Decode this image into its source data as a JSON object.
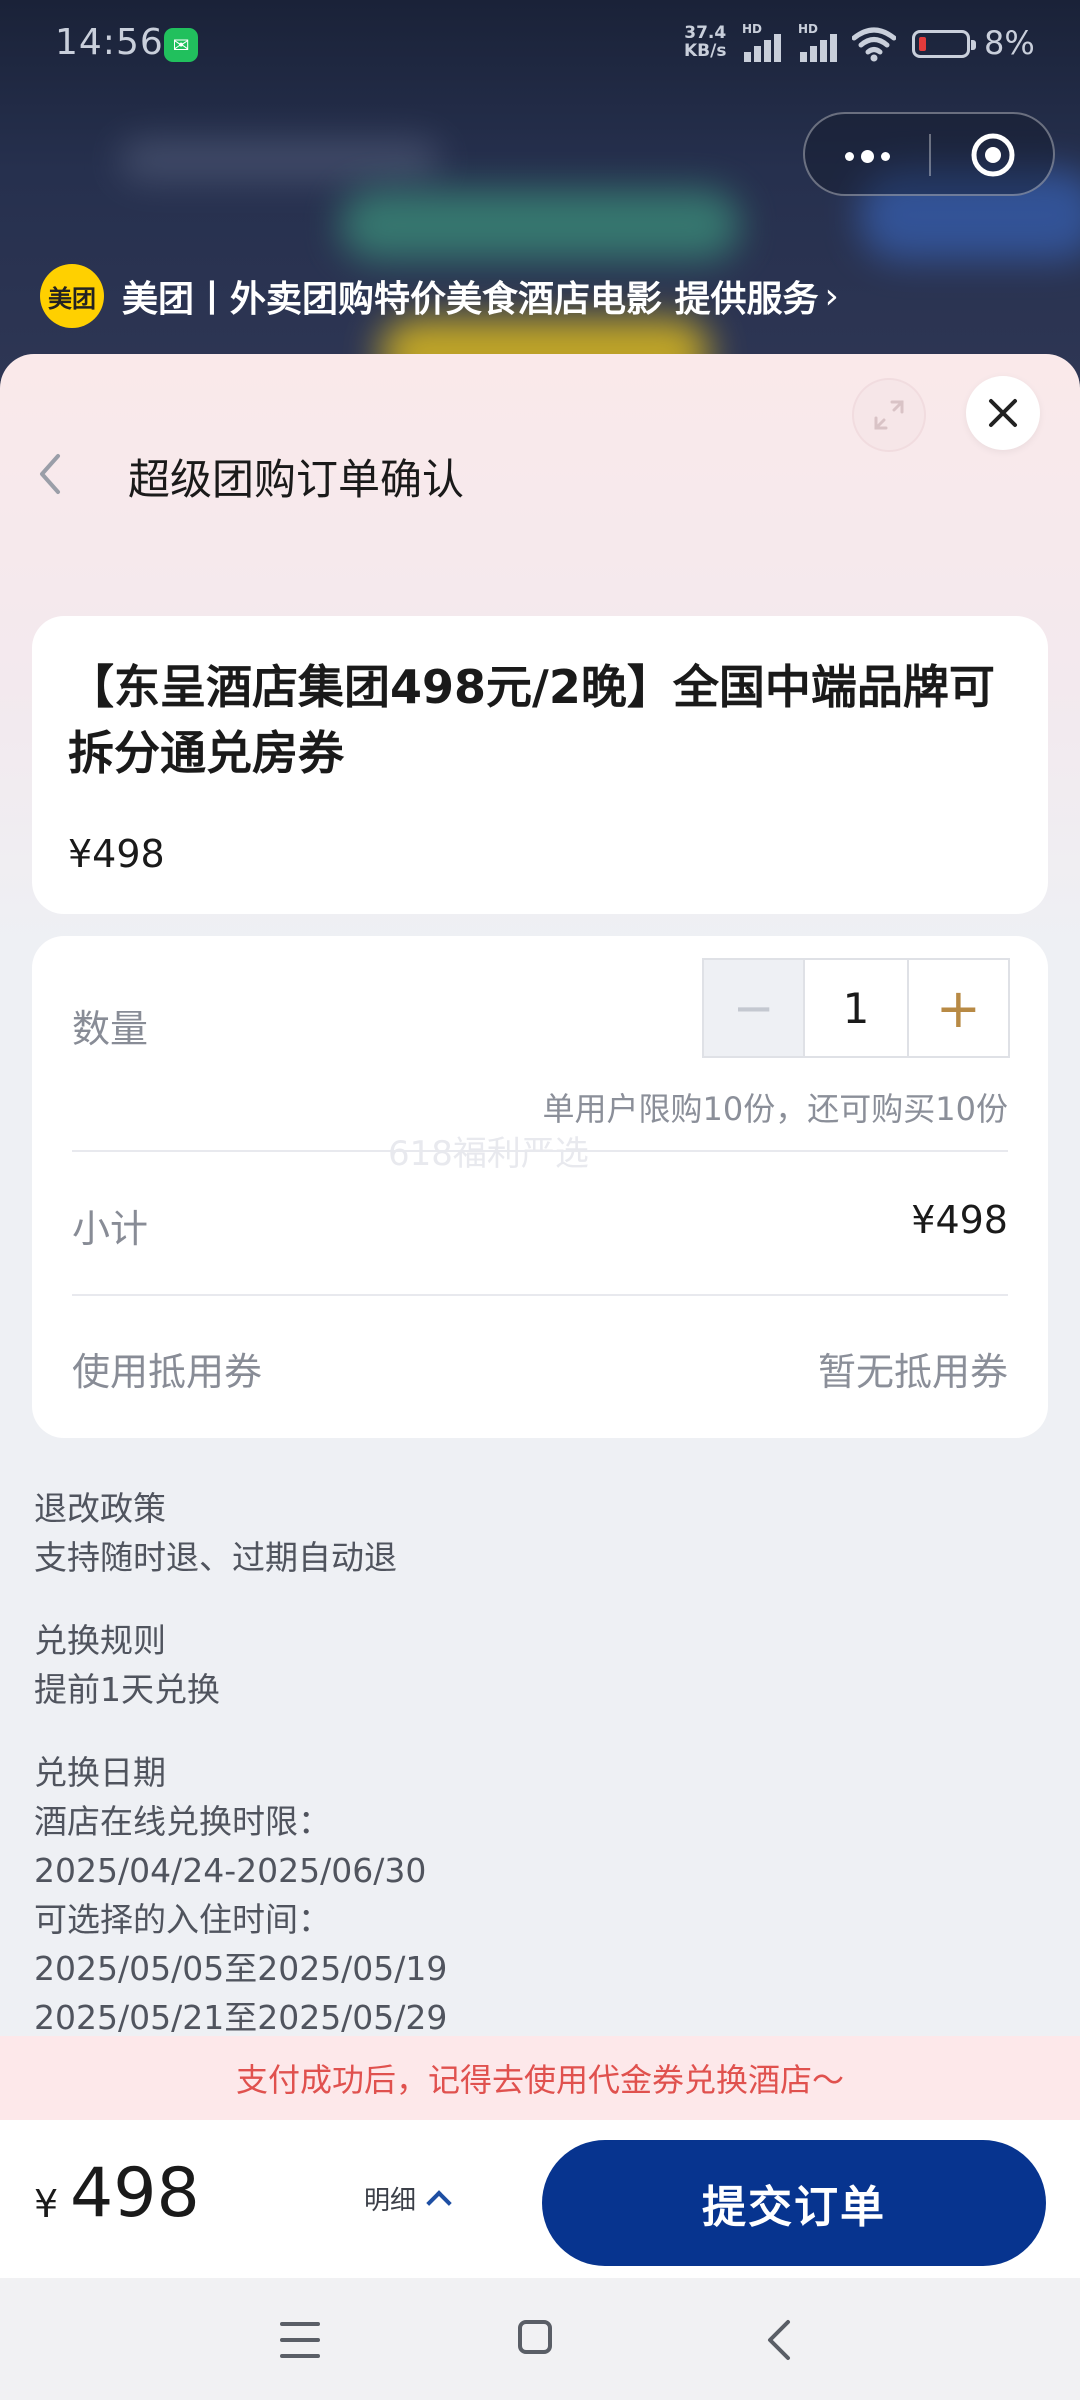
{
  "status_bar": {
    "time": "14:56",
    "net_speed": "37.4",
    "net_unit": "KB/s",
    "battery": "8%",
    "battery_level_pct": 8,
    "icons": [
      "wechat-icon",
      "hd-signal-icon",
      "wifi-icon",
      "battery-icon"
    ]
  },
  "provider": {
    "logo_text": "美团",
    "text": "美团丨外卖团购特价美食酒店电影 提供服务"
  },
  "header": {
    "title": "超级团购订单确认"
  },
  "product": {
    "title": "【东呈酒店集团498元/2晚】全国中端品牌可拆分通兑房券",
    "price": "¥498"
  },
  "order": {
    "quantity_label": "数量",
    "quantity": "1",
    "minus": "−",
    "plus": "+",
    "limit_note": "单用户限购10份，还可购买10份",
    "watermark": "618福利严选",
    "subtotal_label": "小计",
    "subtotal": "¥498",
    "coupon_label": "使用抵用券",
    "coupon_value": "暂无抵用券"
  },
  "policies": {
    "refund_title": "退改政策",
    "refund_text": "支持随时退、过期自动退",
    "exchange_title": "兑换规则",
    "exchange_text": "提前1天兑换",
    "date_title": "兑换日期",
    "online_label": "酒店在线兑换时限：",
    "online_range": "2025/04/24-2025/06/30",
    "checkin_label": "可选择的入住时间：",
    "checkin_range1": "2025/05/05至2025/05/19",
    "checkin_range2": "2025/05/21至2025/05/29"
  },
  "tip": "支付成功后，记得去使用代金券兑换酒店～",
  "footer": {
    "currency": "¥",
    "total": "498",
    "detail_label": "明细",
    "submit_label": "提交订单"
  },
  "colors": {
    "primary": "#07348f",
    "accent_gold": "#b88a45",
    "tip_red": "#e0514e",
    "brand_yellow": "#ffd000"
  }
}
